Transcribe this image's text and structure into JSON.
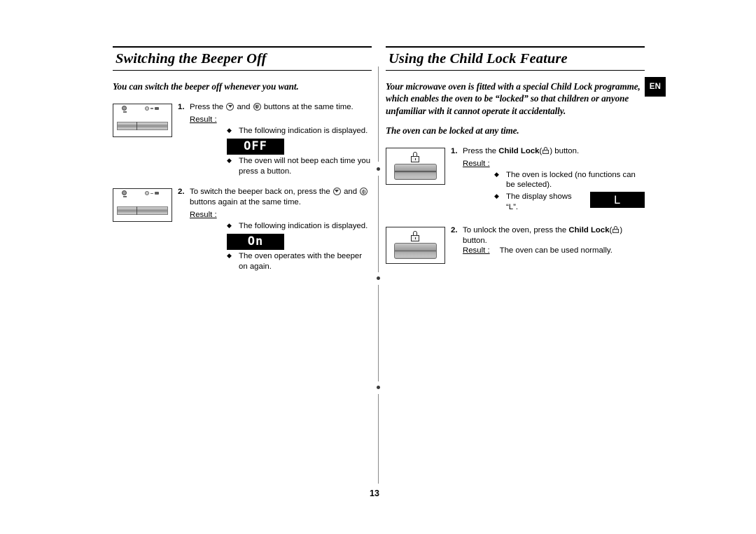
{
  "document": {
    "page_number": "13",
    "language_tab": "EN"
  },
  "left_column": {
    "heading": "Switching the Beeper Off",
    "intro": "You can switch the beeper off whenever you want.",
    "steps": [
      {
        "number": "1.",
        "text_before_icon1": "Press the",
        "icon1": "weight-defrost-icon",
        "text_between": "and",
        "icon2": "power-clock-icon",
        "text_after": "buttons at the same time.",
        "result_label": "Result :",
        "bullets": [
          "The following indication is displayed.",
          "The oven will not beep each time you press a button."
        ],
        "display_value": "OFF",
        "panel": "control-panel-illustration"
      },
      {
        "number": "2.",
        "text_before_icon1": "To switch the beeper back on, press the",
        "icon1": "weight-defrost-icon",
        "text_between": "and",
        "icon2": "power-clock-icon",
        "text_after": "buttons again at the same time.",
        "result_label": "Result :",
        "bullets": [
          "The following indication is displayed.",
          "The oven operates with the beeper on again."
        ],
        "display_value": "On",
        "panel": "control-panel-illustration"
      }
    ]
  },
  "right_column": {
    "heading": "Using the Child Lock Feature",
    "intro_1": "Your microwave oven is fitted with a special Child Lock programme, which enables the oven to be “locked” so that children or anyone unfamiliar with it cannot operate it accidentally.",
    "intro_2": "The oven can be locked at any time.",
    "steps": [
      {
        "number": "1.",
        "text_before_bold": "Press the",
        "bold_label": "Child Lock",
        "text_after_icon": ") button.",
        "open_paren": "(",
        "result_label": "Result :",
        "bullets": [
          "The oven is locked (no functions can be selected).",
          "The display shows “L”."
        ],
        "display_value": "L",
        "panel": "child-lock-panel-illustration"
      },
      {
        "number": "2.",
        "text_before_bold": "To unlock the oven, press the",
        "bold_label": "Child Lock",
        "text_after_icon": ") button.",
        "open_paren": "(",
        "result_label": "Result :",
        "result_text": "The oven can be used normally.",
        "panel": "child-lock-panel-illustration"
      }
    ]
  },
  "colors": {
    "text": "#000000",
    "rule": "#000000",
    "lcd_background": "#000000",
    "lcd_text": "#ffffff",
    "divider": "#8a8a8a"
  }
}
